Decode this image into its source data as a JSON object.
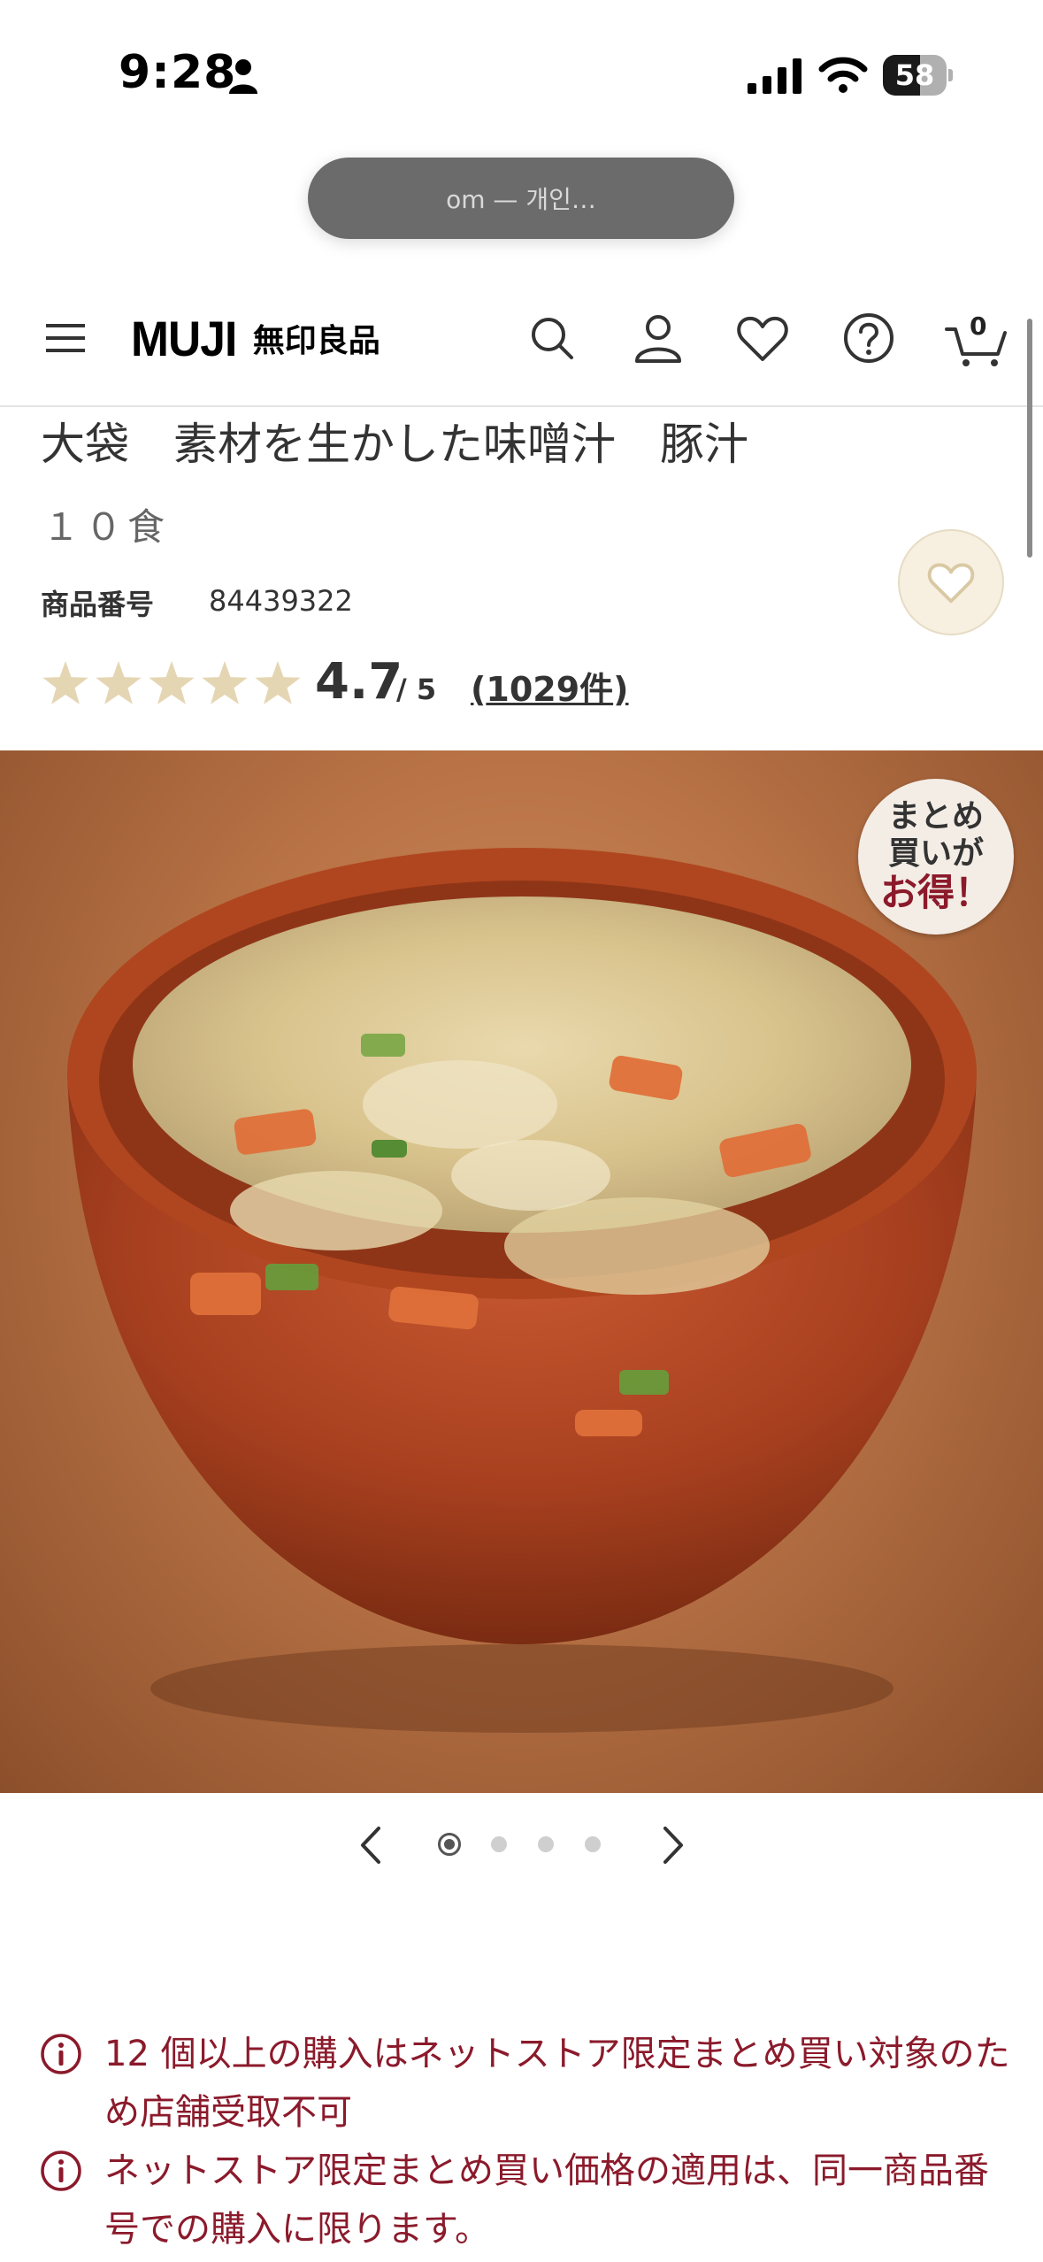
{
  "status_bar": {
    "time": "9:28",
    "battery": "58",
    "battery_level": 0.58
  },
  "browser": {
    "url_text": "om — 개인…"
  },
  "header": {
    "logo_text": "MUJI",
    "logo_jp": "無印良品",
    "cart_count": "0"
  },
  "product": {
    "title": "大袋　素材を生かした味噌汁　豚汁",
    "subtitle": "１０食",
    "number_label": "商品番号",
    "number": "84439322",
    "rating": "4.7",
    "rating_max": "/ 5",
    "review_count": "1029件",
    "rating_value": 4.7
  },
  "badge": {
    "line1": "まとめ",
    "line2": "買いが",
    "line3": "お得！"
  },
  "carousel": {
    "total": 4,
    "active": 0
  },
  "notices": [
    "12 個以上の購入はネットストア限定まとめ買い対象のため店舗受取不可",
    "ネットストア限定まとめ買い価格の適用は、同一商品番号での購入に限ります。"
  ],
  "colors": {
    "star": "#e5d6b3",
    "accent": "#8b1a2b",
    "favorite_bg": "#f7f0e1"
  },
  "icons": [
    "person-icon",
    "signal-icon",
    "wifi-icon",
    "menu-icon",
    "search-icon",
    "account-icon",
    "heart-icon",
    "help-icon",
    "cart-icon",
    "star-icon",
    "info-icon",
    "chevron-left-icon",
    "chevron-right-icon"
  ]
}
